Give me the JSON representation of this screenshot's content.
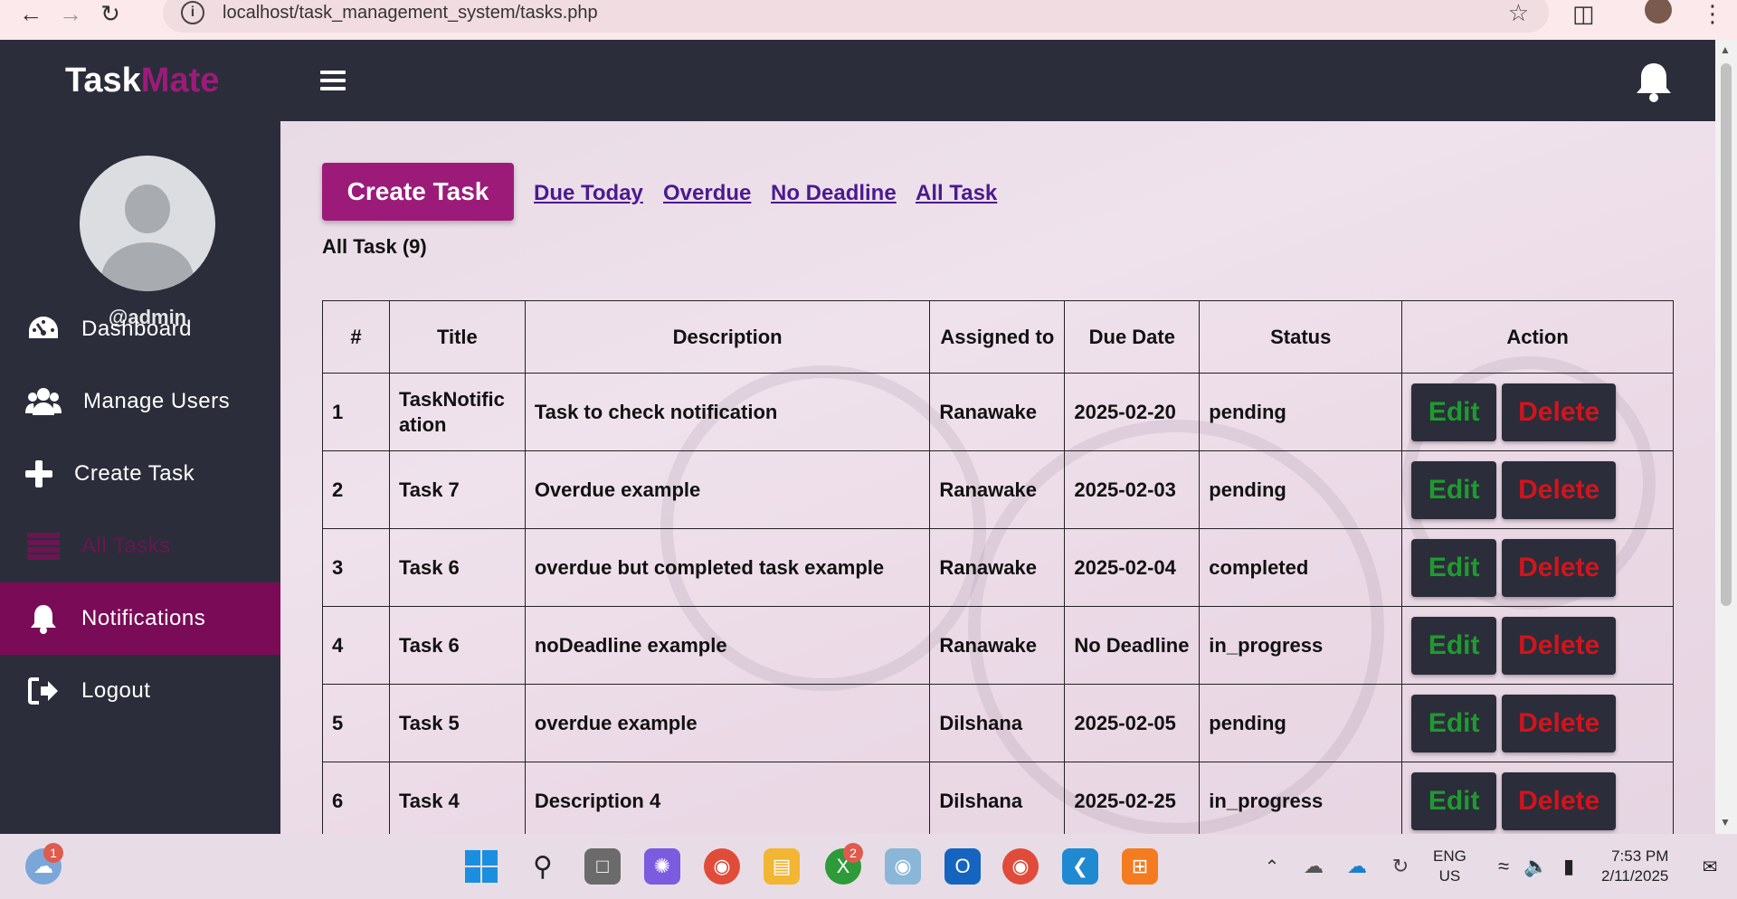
{
  "browser": {
    "url": "localhost/task_management_system/tasks.php"
  },
  "header": {
    "logo_part1": "Task",
    "logo_part2": "Mate"
  },
  "sidebar": {
    "username": "@admin",
    "items": [
      {
        "label": "Dashboard",
        "icon": "dashboard-gauge-icon"
      },
      {
        "label": "Manage Users",
        "icon": "users-icon"
      },
      {
        "label": "Create Task",
        "icon": "plus-icon"
      },
      {
        "label": "All Tasks",
        "icon": "list-icon"
      },
      {
        "label": "Notifications",
        "icon": "bell-icon"
      },
      {
        "label": "Logout",
        "icon": "logout-icon"
      }
    ]
  },
  "toolbar": {
    "create_label": "Create Task",
    "filters": [
      "Due Today",
      "Overdue",
      "No Deadline",
      "All Task"
    ]
  },
  "section_title": "All Task (9)",
  "table": {
    "headers": [
      "#",
      "Title",
      "Description",
      "Assigned to",
      "Due Date",
      "Status",
      "Action"
    ],
    "edit_label": "Edit",
    "delete_label": "Delete",
    "rows": [
      {
        "num": "1",
        "title": "TaskNotification",
        "description": "Task to check notification",
        "assigned": "Ranawake",
        "due": "2025-02-20",
        "status": "pending"
      },
      {
        "num": "2",
        "title": "Task 7",
        "description": "Overdue example",
        "assigned": "Ranawake",
        "due": "2025-02-03",
        "status": "pending"
      },
      {
        "num": "3",
        "title": "Task 6",
        "description": "overdue but completed task example",
        "assigned": "Ranawake",
        "due": "2025-02-04",
        "status": "completed"
      },
      {
        "num": "4",
        "title": "Task 6",
        "description": "noDeadline example",
        "assigned": "Ranawake",
        "due": "No Deadline",
        "status": "in_progress"
      },
      {
        "num": "5",
        "title": "Task 5",
        "description": "overdue example",
        "assigned": "Dilshana",
        "due": "2025-02-05",
        "status": "pending"
      },
      {
        "num": "6",
        "title": "Task 4",
        "description": "Description 4",
        "assigned": "Dilshana",
        "due": "2025-02-25",
        "status": "in_progress"
      }
    ]
  },
  "taskbar": {
    "weather_badge": "1",
    "xbox_badge": "2",
    "language": "ENG",
    "region": "US",
    "time": "7:53 PM",
    "date": "2/11/2025"
  },
  "colors": {
    "brand": "#9c1b79",
    "dark": "#2b2d3a",
    "active_nav": "#7a0c57",
    "edit_text": "#1f9a2f",
    "delete_text": "#d1141c"
  }
}
